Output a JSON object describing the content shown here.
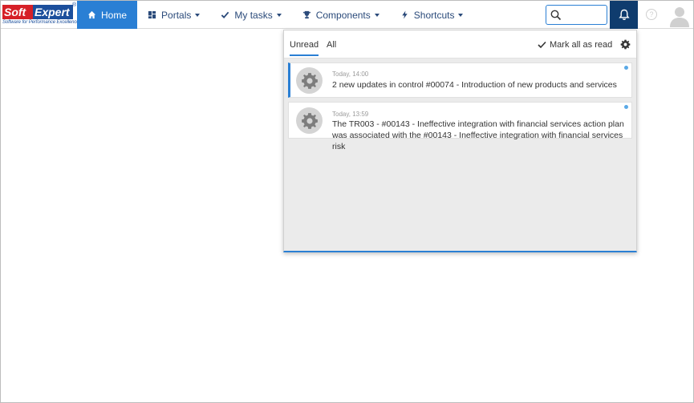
{
  "brand": {
    "soft": "Soft",
    "expert": "Expert",
    "reg": "®",
    "tagline": "Software for Performance Excellence"
  },
  "nav": {
    "items": [
      {
        "label": "Home",
        "icon": "home-icon",
        "active": true,
        "has_caret": false
      },
      {
        "label": "Portals",
        "icon": "dashboard-icon",
        "active": false,
        "has_caret": true
      },
      {
        "label": "My tasks",
        "icon": "checkmark-icon",
        "active": false,
        "has_caret": true
      },
      {
        "label": "Components",
        "icon": "trophy-icon",
        "active": false,
        "has_caret": true
      },
      {
        "label": "Shortcuts",
        "icon": "lightning-icon",
        "active": false,
        "has_caret": true
      }
    ]
  },
  "header": {
    "search_placeholder": "",
    "help_label": "?"
  },
  "notifications": {
    "tabs": [
      {
        "label": "Unread",
        "active": true
      },
      {
        "label": "All",
        "active": false
      }
    ],
    "mark_all_label": "Mark all as read",
    "items": [
      {
        "time": "Today, 14:00",
        "message": "2 new updates in control #00074 - Introduction of new products and services",
        "unread": true
      },
      {
        "time": "Today, 13:59",
        "message": "The TR003 - #00143 - Ineffective integration with financial services action plan was associated with the #00143 - Ineffective integration with financial services risk",
        "unread": true
      }
    ]
  },
  "colors": {
    "accent": "#2a7fd4",
    "nav_text": "#2a4a7a",
    "bell_bg": "#0f3c6e",
    "unread_dot": "#5aa9e6"
  }
}
